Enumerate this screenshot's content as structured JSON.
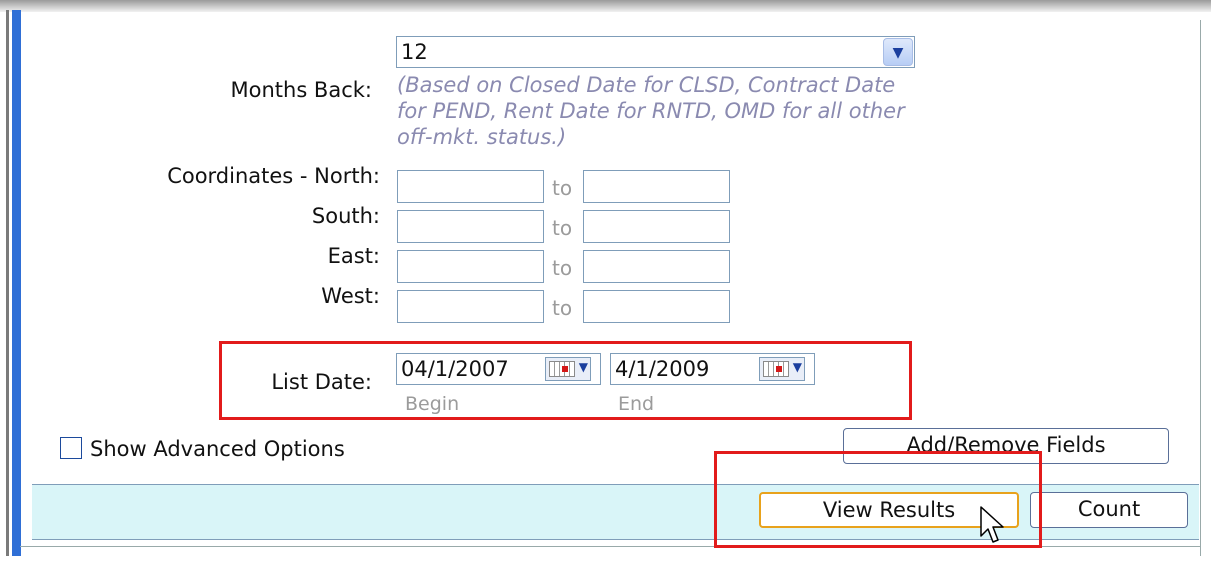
{
  "months_back": {
    "label": "Months Back:",
    "selected": "12",
    "hint": "(Based on Closed Date for CLSD, Contract Date for PEND, Rent Date for RNTD, OMD for all other off-mkt. status.)"
  },
  "coordinates": {
    "north_label": "Coordinates - North:",
    "south_label": "South:",
    "east_label": "East:",
    "west_label": "West:",
    "to": "to"
  },
  "list_date": {
    "label": "List Date:",
    "begin_value": "04/1/2007",
    "end_value": "4/1/2009",
    "begin_caption": "Begin",
    "end_caption": "End"
  },
  "advanced": {
    "label": "Show Advanced Options",
    "checked": false
  },
  "buttons": {
    "add_remove": "Add/Remove Fields",
    "view_results": "View Results",
    "count": "Count"
  },
  "icons": {
    "dropdown": "chevron-down-icon",
    "calendar": "calendar-icon",
    "cursor": "mouse-pointer-icon"
  },
  "colors": {
    "annotation_red": "#e21b1b",
    "footer_bg": "#d9f5f8",
    "primary_border": "#e8a21c",
    "left_accent": "#2f6fd6"
  }
}
